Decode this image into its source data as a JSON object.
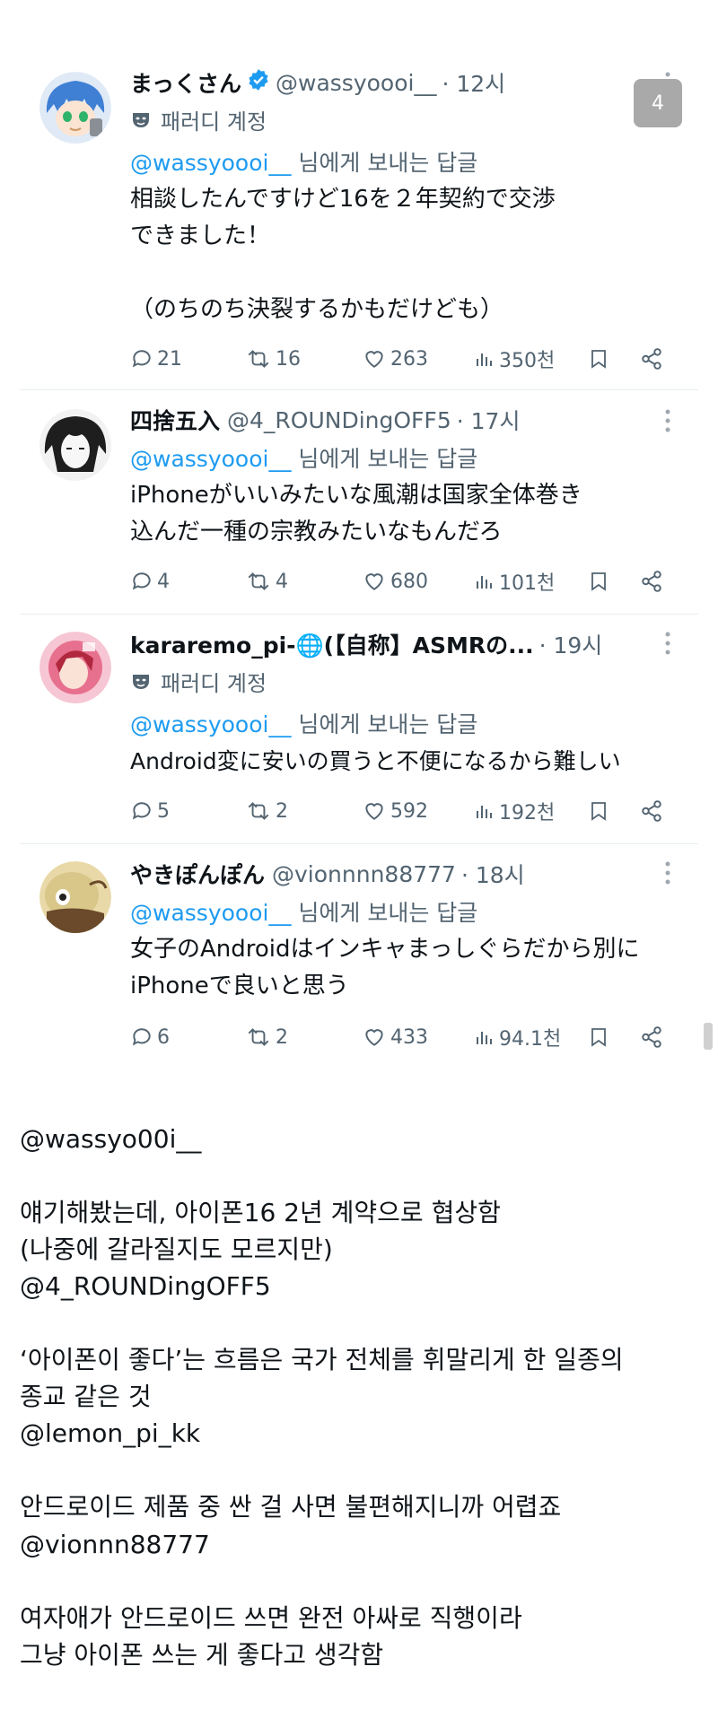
{
  "colors": {
    "link": "#1d9bf0",
    "meta": "#536471",
    "verified": "#1d9bf0"
  },
  "tweets": [
    {
      "name": "まっくさん",
      "handle": "@wassyoooi__",
      "time": "· 12시",
      "verified": true,
      "parody_label": "패러디 계정",
      "reply_mention": "@wassyoooi__",
      "reply_suffix": " 님에게 보내는 답글",
      "body": "相談したんですけど16を２年契約で交渉\nできました！\n\n（のちのち決裂するかもだけども）",
      "stats": {
        "replies": "21",
        "retweets": "16",
        "likes": "263",
        "views": "350천"
      }
    },
    {
      "name": "四捨五入",
      "handle": "@4_ROUNDingOFF5",
      "time": "· 17시",
      "reply_mention": "@wassyoooi__",
      "reply_suffix": " 님에게 보내는 답글",
      "body": "iPhoneがいいみたいな風潮は国家全体巻き\n込んだ一種の宗教みたいなもんだろ",
      "stats": {
        "replies": "4",
        "retweets": "4",
        "likes": "680",
        "views": "101천"
      }
    },
    {
      "name": "kararemo_pi-🌐(【自称】ASMRの...",
      "handle": "",
      "time": "· 19시",
      "parody_label": "패러디 계정",
      "reply_mention": "@wassyoooi__",
      "reply_suffix": " 님에게 보내는 답글",
      "body": "Android変に安いの買うと不便になるから難しい",
      "stats": {
        "replies": "5",
        "retweets": "2",
        "likes": "592",
        "views": "192천"
      }
    },
    {
      "name": "やきぽんぽん",
      "handle": "@vionnnn88777",
      "time": "· 18시",
      "reply_mention": "@wassyoooi__",
      "reply_suffix": " 님에게 보내는 답글",
      "body": "女子のAndroidはインキャまっしぐらだから別に\niPhoneで良いと思う",
      "stats": {
        "replies": "6",
        "retweets": "2",
        "likes": "433",
        "views": "94.1천"
      }
    }
  ],
  "badge": "4",
  "translations": [
    {
      "handle": "@wassyo00i__",
      "text": "얘기해봤는데, 아이폰16 2년 계약으로 협상함\n(나중에 갈라질지도 모르지만)"
    },
    {
      "handle": "@4_ROUNDingOFF5",
      "text": "‘아이폰이 좋다’는 흐름은 국가 전체를 휘말리게 한 일종의\n종교 같은 것"
    },
    {
      "handle": "@lemon_pi_kk",
      "text": "안드로이드 제품 중 싼 걸 사면 불편해지니까 어렵죠"
    },
    {
      "handle": "@vionnn88777",
      "text": "여자애가 안드로이드 쓰면 완전 아싸로 직행이라\n그냥 아이폰 쓰는 게 좋다고 생각함"
    }
  ]
}
